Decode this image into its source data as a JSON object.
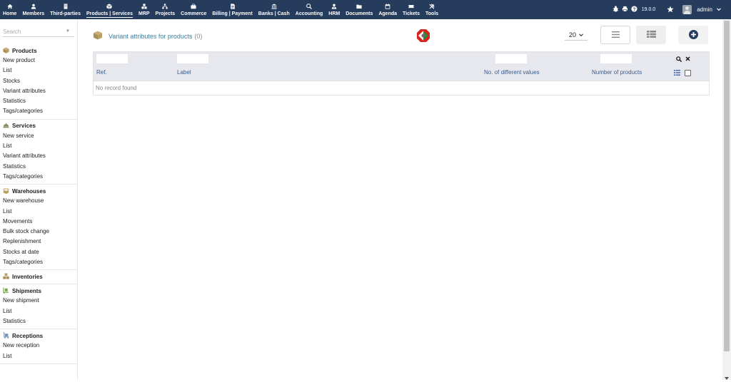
{
  "topnav": [
    {
      "label": "Home",
      "icon": "home-icon"
    },
    {
      "label": "Members",
      "icon": "member-icon"
    },
    {
      "label": "Third-parties",
      "icon": "building-icon"
    },
    {
      "label": "Products | Services",
      "icon": "cube-icon",
      "active": true
    },
    {
      "label": "MRP",
      "icon": "cubes-icon"
    },
    {
      "label": "Projects",
      "icon": "sitemap-icon"
    },
    {
      "label": "Commerce",
      "icon": "briefcase-icon"
    },
    {
      "label": "Billing | Payment",
      "icon": "invoice-icon"
    },
    {
      "label": "Banks | Cash",
      "icon": "bank-icon"
    },
    {
      "label": "Accounting",
      "icon": "search-dollar-icon"
    },
    {
      "label": "HRM",
      "icon": "user-tie-icon"
    },
    {
      "label": "Documents",
      "icon": "folder-icon"
    },
    {
      "label": "Agenda",
      "icon": "calendar-icon"
    },
    {
      "label": "Tickets",
      "icon": "ticket-icon"
    },
    {
      "label": "Tools",
      "icon": "tools-icon"
    }
  ],
  "topright": {
    "version": "19.0.0",
    "username": "admin",
    "icons": [
      "bug-icon",
      "print-icon",
      "help-icon",
      "star-icon",
      "avatar",
      "chevron-down-icon"
    ]
  },
  "sidebar": {
    "search_placeholder": "Search",
    "sections": [
      {
        "title": "Products",
        "icon": "cube-icon",
        "links": [
          "New product",
          "List",
          "Stocks",
          "Variant attributes",
          "Statistics",
          "Tags/categories"
        ]
      },
      {
        "title": "Services",
        "icon": "concierge-icon",
        "links": [
          "New service",
          "List",
          "Variant attributes",
          "Statistics",
          "Tags/categories"
        ]
      },
      {
        "title": "Warehouses",
        "icon": "box-open-icon",
        "links": [
          "New warehouse",
          "List",
          "Movements",
          "Bulk stock change",
          "Replenishment",
          "Stocks at date",
          "Tags/categories"
        ]
      },
      {
        "title": "Inventories",
        "icon": "boxes-icon",
        "links": []
      },
      {
        "title": "Shipments",
        "icon": "dolly-icon",
        "links": [
          "New shipment",
          "List",
          "Statistics"
        ]
      },
      {
        "title": "Receptions",
        "icon": "dolly-flatbed-icon",
        "links": [
          "New reception",
          "List"
        ]
      }
    ]
  },
  "main": {
    "title": "Variant attributes for products",
    "count": "(0)",
    "per_page": "20",
    "columns": [
      "Ref.",
      "Label",
      "No. of different values",
      "Number of products"
    ],
    "empty_message": "No record found"
  },
  "colors": {
    "topbar": "#263c5c",
    "title": "#3b7f9d",
    "column_label": "#3b5b8c",
    "filter_bg": "#e6e8ee",
    "add_button": "#263c5c"
  }
}
